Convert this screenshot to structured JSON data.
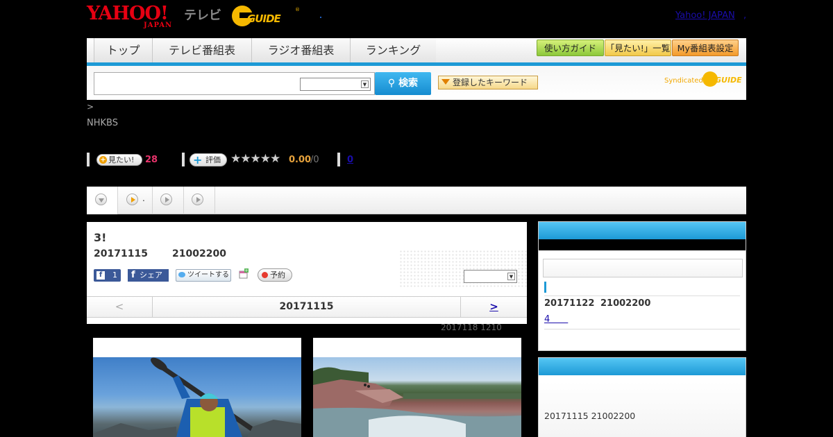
{
  "header": {
    "logo_yahoo": "YAHOO!",
    "logo_japan": "JAPAN",
    "logo_tv": "テレビ",
    "logo_gguide": "GUIDE",
    "logo_gguide_reg": "®",
    "yahoo_link": "Yahoo! JAPAN",
    "yahoo_link_trailing": ","
  },
  "nav": {
    "tabs": [
      {
        "label": "トップ"
      },
      {
        "label": "テレビ番組表"
      },
      {
        "label": "ラジオ番組表"
      },
      {
        "label": "ランキング"
      }
    ],
    "pills": [
      {
        "label": "使い方ガイド"
      },
      {
        "label": "「見たい!」一覧"
      },
      {
        "label": "My番組表設定"
      }
    ]
  },
  "search": {
    "input_value": "",
    "select_value": "",
    "button_label": "検索",
    "keyword_button_label": "登録したキーワード",
    "syndicated_label": "Syndicated",
    "syndicated_logo": "GUIDE"
  },
  "breadcrumb": {
    "text": ">"
  },
  "channel": {
    "name": "NHKBS"
  },
  "stats": {
    "wish_label": "見たい!",
    "wish_count": "28",
    "rate_label": "評価",
    "stars": "★★★★★",
    "rating_value": "0.00",
    "rating_denominator": "/0",
    "review_count": "0"
  },
  "subtabs": [
    {
      "label": ""
    },
    {
      "label": "."
    },
    {
      "label": ""
    },
    {
      "label": ""
    }
  ],
  "program": {
    "title": "3!",
    "date": "20171115",
    "time": "21002200",
    "like_count": "1",
    "share_label": "シェア",
    "tweet_label": "ツイートする",
    "reserve_label": "予約",
    "select_value": "",
    "prev_label": "<",
    "nav_date": "20171115",
    "next_label": ">",
    "updated": "2017118  1210"
  },
  "sidebar": {
    "box1": {
      "date": "20171122",
      "time": "21002200",
      "link_text": "4　　"
    },
    "box2": {
      "text": "20171115  21002200"
    }
  },
  "colors": {
    "accent_blue": "#1d9ad6",
    "yahoo_red": "#e60012",
    "gguide_yellow": "#f5b800",
    "wish_pink": "#e8336b",
    "rating_orange": "#e6a23c"
  }
}
